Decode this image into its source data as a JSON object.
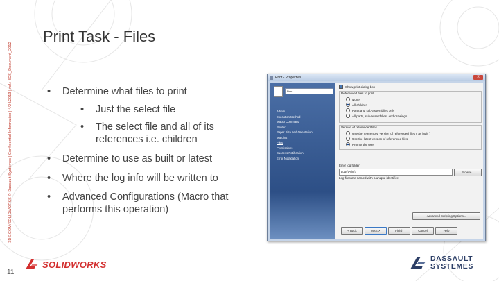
{
  "slide": {
    "vertical_label": "3DS.COM/SOLIDWORKS © Dassault Systèmes | Confidential Information | 4/24/2013 | ref.: 3DS_Document_2012",
    "title": "Print Task - Files",
    "page_number": "11",
    "bullets": [
      {
        "level": 1,
        "text": "Determine what files to print"
      },
      {
        "level": 2,
        "text": "Just the select file"
      },
      {
        "level": 2,
        "text": "The select file and all of its references i.e. children"
      },
      {
        "level": 1,
        "text": "Determine to use as built or latest"
      },
      {
        "level": 1,
        "text": "Where the log info will be written to"
      },
      {
        "level": 1,
        "text": "Advanced Configurations (Macro that performs this operation)"
      }
    ],
    "brand_left": "SOLIDWORKS",
    "brand_right_line1": "DASSAULT",
    "brand_right_line2": "SYSTEMES",
    "colors": {
      "brand_red": "#d32f2f",
      "brand_navy": "#2c3e66"
    }
  },
  "dialog": {
    "title": "Print - Properties",
    "close_label": "X",
    "task_name": "Print",
    "nav_items": [
      "Admin",
      "Execution Method",
      "Macro Command",
      "Printer",
      "Paper Size and Orientation",
      "Margins",
      "Files",
      "Permissions",
      "Success Notification",
      "Error Notification"
    ],
    "active_nav_index": 6,
    "show_dialog_label": "Show print dialog box",
    "references_title": "Referenced files to print",
    "ref_options": [
      "None",
      "All children",
      "Parts and sub-assemblies only",
      "All parts, sub-assemblies, and drawings"
    ],
    "ref_selected": 1,
    "version_title": "Version of referenced files",
    "version_options": [
      "Use the referenced version of referenced files (\"as built\")",
      "Use the latest version of referenced files",
      "Prompt the user"
    ],
    "version_selected": 2,
    "error_log_label": "Error log folder:",
    "error_log_value": "Logs\\Print\\",
    "browse_label": "Browse...",
    "log_note": "Log files are named with a unique identifier.",
    "advanced_label": "Advanced Scripting Options...",
    "back_label": "< Back",
    "next_label": "Next >",
    "finish_label": "Finish",
    "cancel_label": "Cancel",
    "help_label": "Help"
  }
}
